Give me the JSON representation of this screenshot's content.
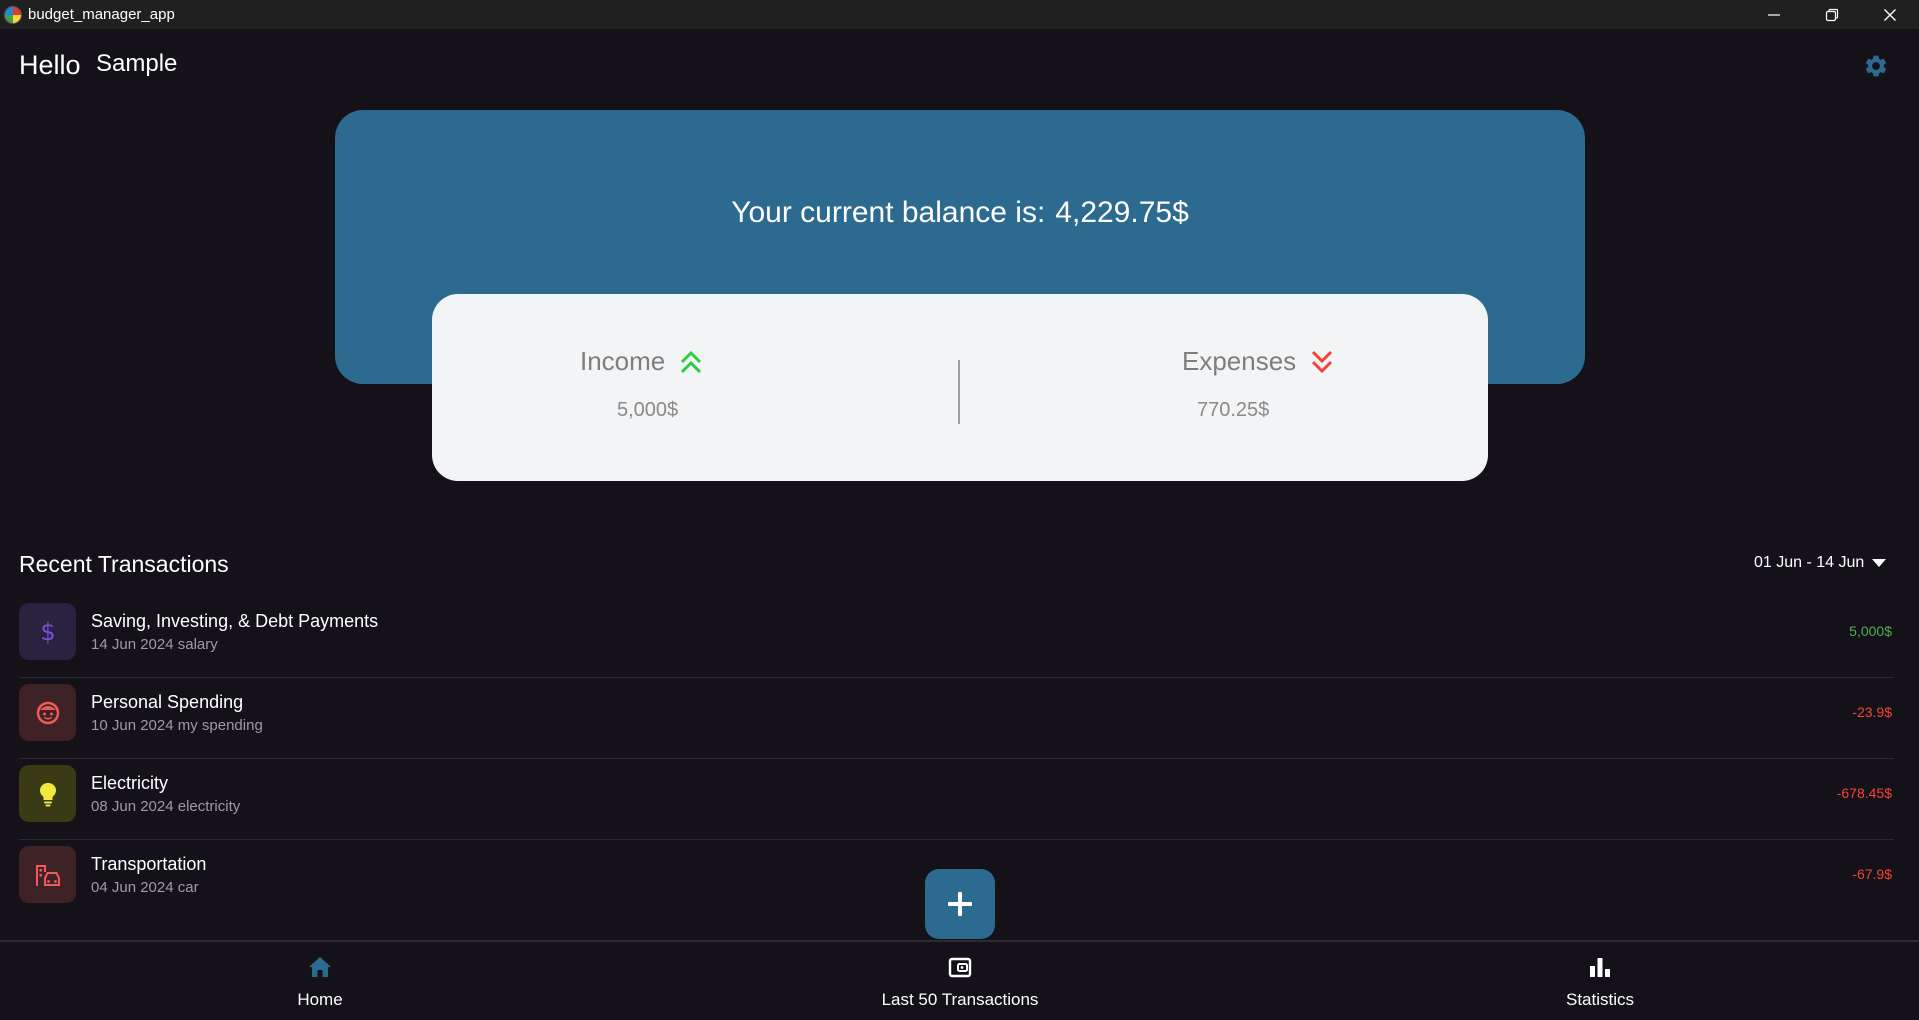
{
  "window": {
    "title": "budget_manager_app"
  },
  "header": {
    "greeting": "Hello",
    "username": "Sample",
    "settings_icon": "gear-icon"
  },
  "balance": {
    "label": "Your current balance is:",
    "amount": "4,229.75$"
  },
  "summary": {
    "income_label": "Income",
    "income_value": "5,000$",
    "expenses_label": "Expenses",
    "expenses_value": "770.25$"
  },
  "recent": {
    "title": "Recent Transactions",
    "date_range": "01 Jun - 14 Jun",
    "transactions": [
      {
        "name": "Saving, Investing, & Debt Payments",
        "subtitle": "14 Jun 2024 salary",
        "amount": "5,000$",
        "icon": "dollar-icon",
        "amount_color": "#4caf50"
      },
      {
        "name": "Personal Spending",
        "subtitle": "10 Jun 2024 my spending",
        "amount": "-23.9$",
        "icon": "face-icon",
        "amount_color": "#f44336"
      },
      {
        "name": "Electricity",
        "subtitle": "08 Jun 2024 electricity",
        "amount": "-678.45$",
        "icon": "lightbulb-icon",
        "amount_color": "#f44336"
      },
      {
        "name": "Transportation",
        "subtitle": "04 Jun 2024 car",
        "amount": "-67.9$",
        "icon": "car-icon",
        "amount_color": "#f44336"
      }
    ]
  },
  "nav": {
    "home": "Home",
    "last50": "Last 50 Transactions",
    "statistics": "Statistics"
  },
  "colors": {
    "accent": "#2d6a8f",
    "income": "#4caf50",
    "expense": "#f44336"
  }
}
